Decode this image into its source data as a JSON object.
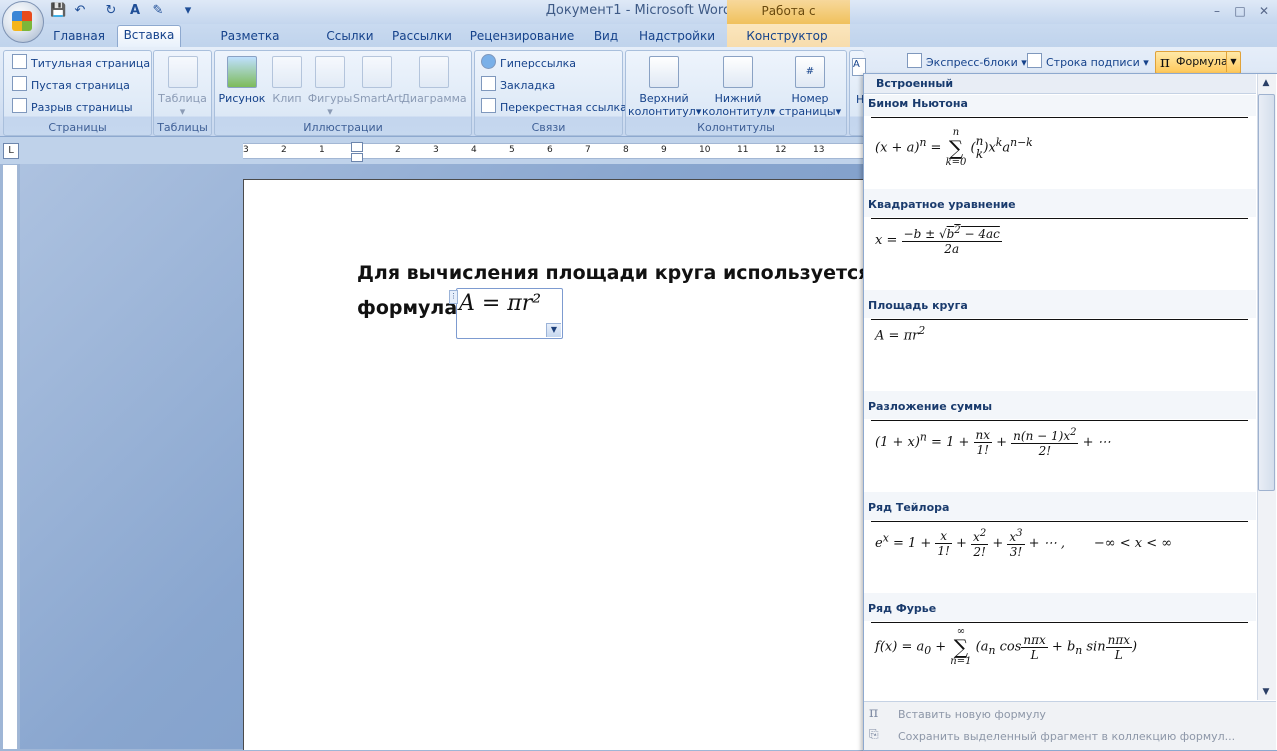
{
  "window": {
    "title": "Документ1 - Microsoft Word",
    "context_tab_group": "Работа с формулами",
    "controls": [
      "–",
      "□",
      "✕"
    ]
  },
  "qat": {
    "save": "💾",
    "undo": "↶",
    "redo": "↻",
    "spelling": "A",
    "customize": "▾"
  },
  "tabs": [
    "Главная",
    "Вставка",
    "Разметка страницы",
    "Ссылки",
    "Рассылки",
    "Рецензирование",
    "Вид",
    "Надстройки",
    "Конструктор"
  ],
  "active_tab": "Вставка",
  "ribbon": {
    "pages": {
      "label": "Страницы",
      "items": [
        "Титульная страница",
        "Пустая страница",
        "Разрыв страницы"
      ]
    },
    "tables": {
      "label": "Таблицы",
      "table": "Таблица"
    },
    "illustrations": {
      "label": "Иллюстрации",
      "picture": "Рисунок",
      "clip": "Клип",
      "shapes": "Фигуры",
      "smartart": "SmartArt",
      "chart": "Диаграмма"
    },
    "links": {
      "label": "Связи",
      "items": [
        "Гиперссылка",
        "Закладка",
        "Перекрестная ссылка"
      ]
    },
    "headers": {
      "label": "Колонтитулы",
      "header_line1": "Верхний",
      "header_line2": "колонтитул",
      "footer_line1": "Нижний",
      "footer_line2": "колонтитул",
      "pagenum_line1": "Номер",
      "pagenum_line2": "страницы"
    },
    "text": {
      "quick_parts": "Экспресс-блоки",
      "signature_line": "Строка подписи",
      "textbox_partial": "Н"
    },
    "formula_button": "Формула"
  },
  "ruler": {
    "labels": [
      "3",
      "2",
      "1",
      "1",
      "2",
      "3",
      "4",
      "5",
      "6",
      "7",
      "8",
      "9",
      "10",
      "11",
      "12",
      "13"
    ],
    "corner": "L"
  },
  "document": {
    "line1": "Для вычисления площади круга используется сл",
    "line2": "формула:",
    "equation": "A = πr²"
  },
  "gallery": {
    "header": "Встроенный",
    "items": [
      {
        "title": "Бином Ньютона"
      },
      {
        "title": "Квадратное уравнение"
      },
      {
        "title": "Площадь круга"
      },
      {
        "title": "Разложение суммы"
      },
      {
        "title": "Ряд Тейлора"
      },
      {
        "title": "Ряд Фурье"
      }
    ],
    "footer": {
      "insert_new": "Вставить новую формулу",
      "save_selection": "Сохранить выделенный фрагмент в коллекцию формул..."
    }
  },
  "colors": {
    "accent": "#15428b",
    "context_tab": "#f0c15c",
    "ribbon_bg": "#dce8f6"
  }
}
